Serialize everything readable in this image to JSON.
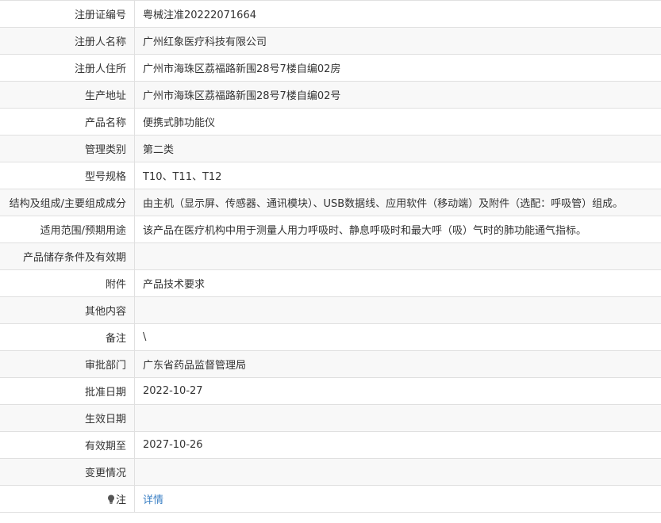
{
  "rows": [
    {
      "label": "注册证编号",
      "value": "粤械注准20222071664"
    },
    {
      "label": "注册人名称",
      "value": "广州红象医疗科技有限公司"
    },
    {
      "label": "注册人住所",
      "value": "广州市海珠区荔福路新围28号7楼自编02房"
    },
    {
      "label": "生产地址",
      "value": "广州市海珠区荔福路新围28号7楼自编02号"
    },
    {
      "label": "产品名称",
      "value": "便携式肺功能仪"
    },
    {
      "label": "管理类别",
      "value": "第二类"
    },
    {
      "label": "型号规格",
      "value": "T10、T11、T12"
    },
    {
      "label": "结构及组成/主要组成成分",
      "value": "由主机（显示屏、传感器、通讯模块）、USB数据线、应用软件（移动端）及附件（选配：呼吸管）组成。"
    },
    {
      "label": "适用范围/预期用途",
      "value": "该产品在医疗机构中用于测量人用力呼吸时、静息呼吸时和最大呼（吸）气时的肺功能通气指标。"
    },
    {
      "label": "产品储存条件及有效期",
      "value": ""
    },
    {
      "label": "附件",
      "value": "产品技术要求"
    },
    {
      "label": "其他内容",
      "value": ""
    },
    {
      "label": "备注",
      "value": "\\"
    },
    {
      "label": "审批部门",
      "value": "广东省药品监督管理局"
    },
    {
      "label": "批准日期",
      "value": "2022-10-27"
    },
    {
      "label": "生效日期",
      "value": ""
    },
    {
      "label": "有效期至",
      "value": "2027-10-26"
    },
    {
      "label": "变更情况",
      "value": ""
    }
  ],
  "note_row": {
    "label": "注",
    "icon": "lightbulb-icon",
    "link": "详情",
    "link_color": "#3a7fc4"
  }
}
